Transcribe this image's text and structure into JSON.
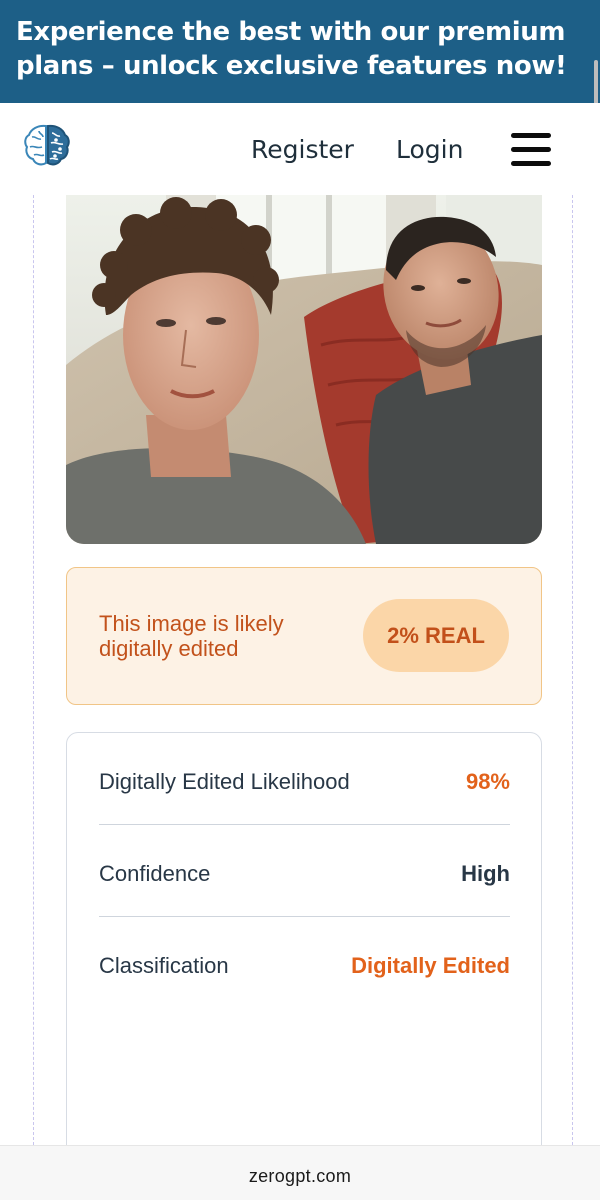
{
  "banner": {
    "line1": "Experience the best with our premium",
    "line2": "plans – unlock exclusive features now!"
  },
  "header": {
    "logo": "brain-logo",
    "register_label": "Register",
    "login_label": "Login",
    "menu_icon": "hamburger-menu-icon"
  },
  "photo": {
    "subject": "uploaded-photo"
  },
  "verdict": {
    "message": "This image is likely digitally edited",
    "badge": "2% REAL"
  },
  "stats": {
    "rows": [
      {
        "label": "Digitally Edited Likelihood",
        "value": "98%",
        "color": "#e2621b"
      },
      {
        "label": "Confidence",
        "value": "High",
        "color": "#283746"
      },
      {
        "label": "Classification",
        "value": "Digitally Edited",
        "color": "#e2621b"
      }
    ]
  },
  "browser": {
    "url": "zerogpt.com"
  },
  "colors": {
    "banner_bg": "#1d5f87",
    "verdict_bg": "#fdf2e5",
    "badge_bg": "#fbd6a8",
    "accent_orange": "#e2621b"
  }
}
